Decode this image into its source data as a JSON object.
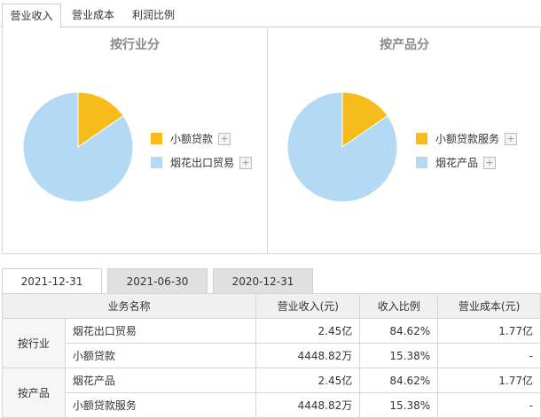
{
  "top_tabs": [
    "营业收入",
    "营业成本",
    "利润比例"
  ],
  "panels": {
    "left": {
      "title": "按行业分",
      "legend": [
        {
          "label": "小额贷款",
          "color": "#f5bc1c"
        },
        {
          "label": "烟花出口贸易",
          "color": "#b3d9f5"
        }
      ],
      "slices": [
        15.38,
        84.62
      ]
    },
    "right": {
      "title": "按产品分",
      "legend": [
        {
          "label": "小额贷款服务",
          "color": "#f5bc1c"
        },
        {
          "label": "烟花产品",
          "color": "#b3d9f5"
        }
      ],
      "slices": [
        15.38,
        84.62
      ]
    },
    "plus_symbol": "+"
  },
  "date_tabs": [
    "2021-12-31",
    "2021-06-30",
    "2020-12-31"
  ],
  "table": {
    "headers": [
      "业务名称",
      "营业收入(元)",
      "收入比例",
      "营业成本(元)"
    ],
    "groups": [
      {
        "label": "按行业",
        "rows": [
          {
            "name": "烟花出口贸易",
            "revenue": "2.45亿",
            "ratio": "84.62%",
            "cost": "1.77亿"
          },
          {
            "name": "小额贷款",
            "revenue": "4448.82万",
            "ratio": "15.38%",
            "cost": "-"
          }
        ]
      },
      {
        "label": "按产品",
        "rows": [
          {
            "name": "烟花产品",
            "revenue": "2.45亿",
            "ratio": "84.62%",
            "cost": "1.77亿"
          },
          {
            "name": "小额贷款服务",
            "revenue": "4448.82万",
            "ratio": "15.38%",
            "cost": "-"
          }
        ]
      }
    ]
  }
}
